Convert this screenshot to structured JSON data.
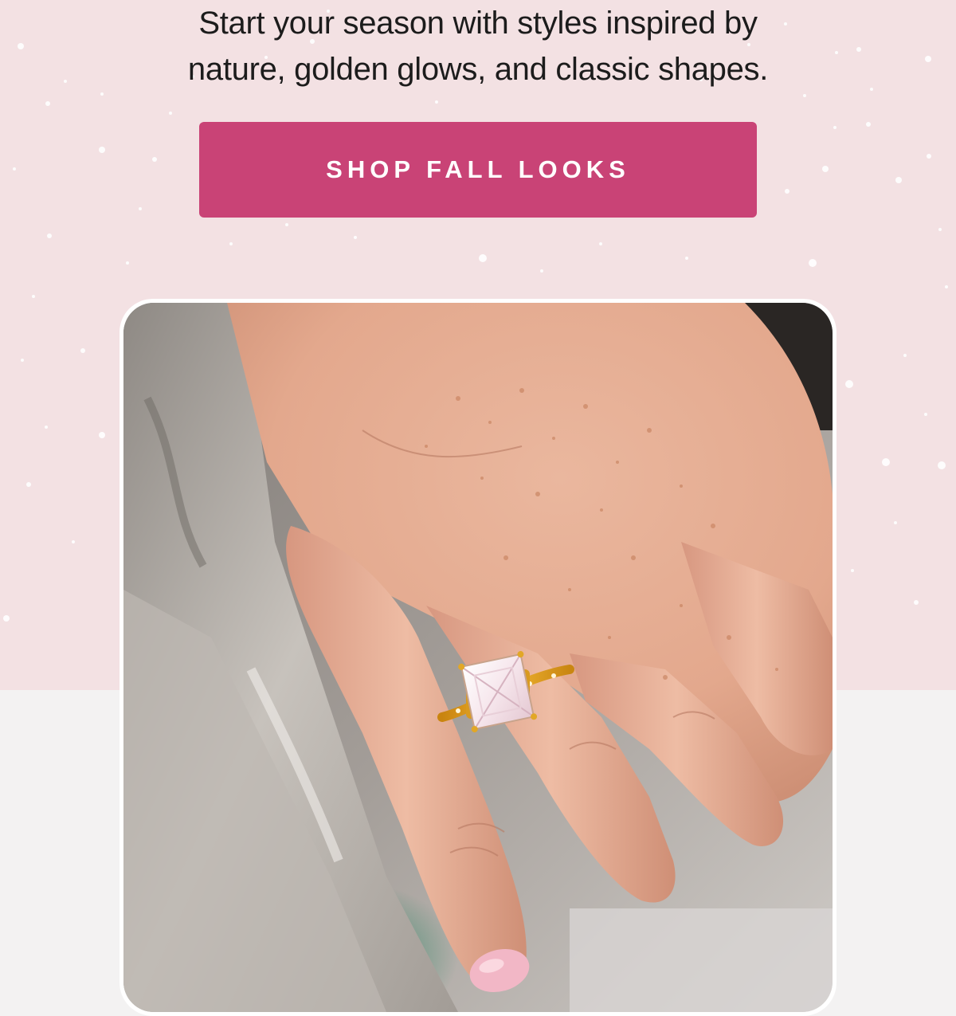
{
  "intro": {
    "line1": "Start your season with styles inspired by",
    "line2": "nature, golden glows, and classic shapes."
  },
  "cta": {
    "label": "SHOP FALL LOOKS"
  },
  "colors": {
    "hero_background": "#f3e1e3",
    "page_background": "#f3f2f2",
    "cta_background": "#c94376",
    "cta_text": "#ffffff",
    "text": "#1c1c1c"
  },
  "image": {
    "icon": "hand-with-ring-photo"
  }
}
